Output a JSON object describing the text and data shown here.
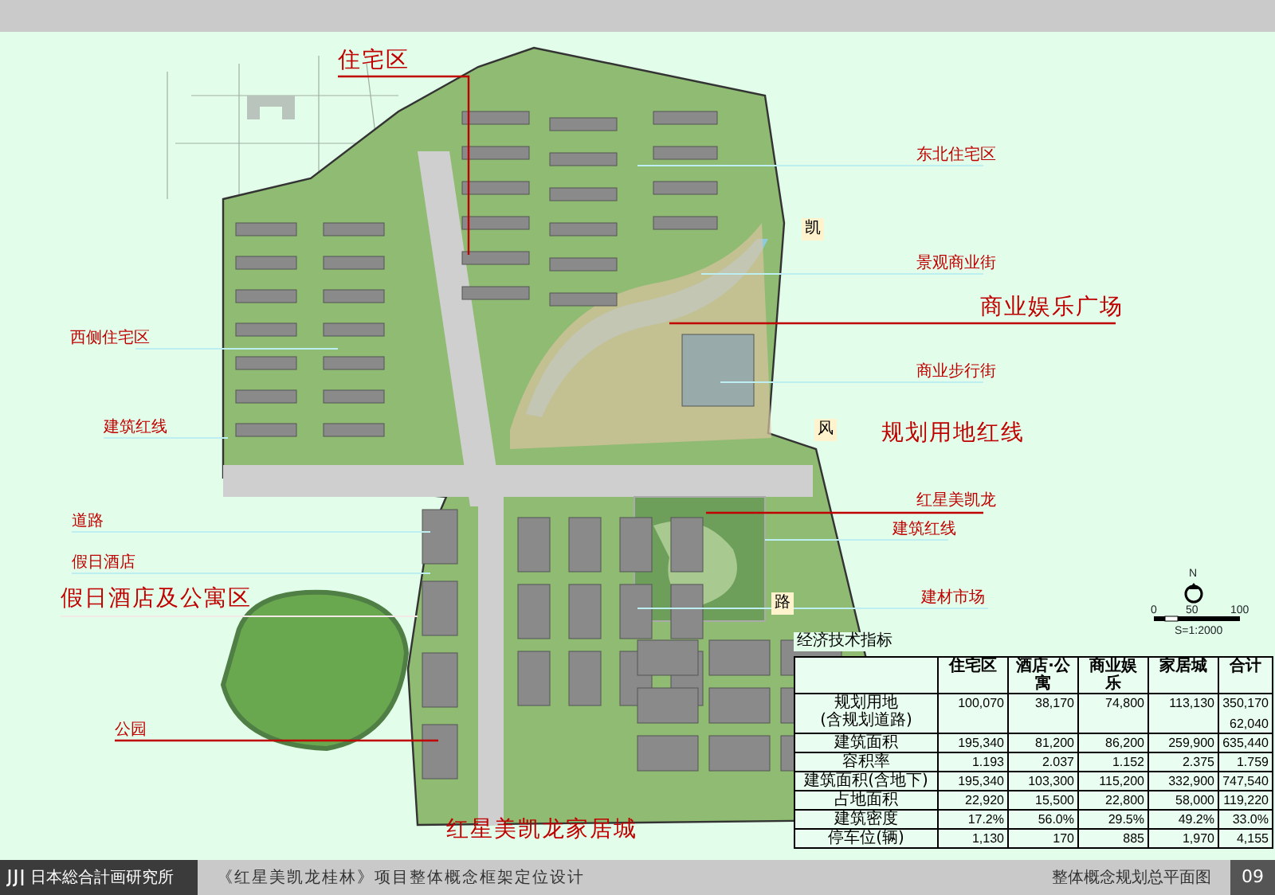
{
  "plan_labels": [
    {
      "kind": "zone",
      "text": "住宅区"
    },
    {
      "kind": "note",
      "text": "东北住宅区"
    },
    {
      "kind": "note",
      "text": "景观商业街"
    },
    {
      "kind": "zone",
      "text": "商业娱乐广场"
    },
    {
      "kind": "note",
      "text": "商业步行街"
    },
    {
      "kind": "zone",
      "text": "规划用地红线"
    },
    {
      "kind": "note",
      "text": "红星美凯龙"
    },
    {
      "kind": "note",
      "text": "建筑红线"
    },
    {
      "kind": "note",
      "text": "建材市场"
    },
    {
      "kind": "note",
      "text": "西侧住宅区"
    },
    {
      "kind": "note",
      "text": "建筑红线"
    },
    {
      "kind": "note",
      "text": "道路"
    },
    {
      "kind": "note",
      "text": "假日酒店"
    },
    {
      "kind": "zone",
      "text": "假日酒店及公寓区"
    },
    {
      "kind": "note",
      "text": "公园"
    },
    {
      "kind": "zone",
      "text": "红星美凯龙家居城"
    }
  ],
  "map_marks": [
    "凯",
    "风",
    "路"
  ],
  "compass": {
    "label": "N"
  },
  "scale_bar": {
    "ticks": [
      "0",
      "50",
      "100"
    ],
    "ratio": "S=1:2000"
  },
  "table": {
    "title": "经济技术指标",
    "columns": [
      "住宅区",
      "酒店·公寓",
      "商业娱乐",
      "家居城",
      "合计"
    ],
    "rows": [
      {
        "label": "规划用地",
        "note": "(含规划道路)",
        "cells": [
          "100,070",
          "38,170",
          "74,800",
          "113,130",
          "350,170"
        ],
        "total_note": "62,040"
      },
      {
        "label": "建筑面积",
        "cells": [
          "195,340",
          "81,200",
          "86,200",
          "259,900",
          "635,440"
        ]
      },
      {
        "label": "容积率",
        "cells": [
          "1.193",
          "2.037",
          "1.152",
          "2.375",
          "1.759"
        ]
      },
      {
        "label": "建筑面积(含地下)",
        "cells": [
          "195,340",
          "103,300",
          "115,200",
          "332,900",
          "747,540"
        ]
      },
      {
        "label": "占地面积",
        "cells": [
          "22,920",
          "15,500",
          "22,800",
          "58,000",
          "119,220"
        ]
      },
      {
        "label": "建筑密度",
        "cells": [
          "17.2%",
          "56.0%",
          "29.5%",
          "49.2%",
          "33.0%"
        ]
      },
      {
        "label": "停车位(辆)",
        "cells": [
          "1,130",
          "170",
          "885",
          "1,970",
          "4,155"
        ]
      }
    ]
  },
  "footer": {
    "logo": "日本総合計画研究所",
    "title": "《红星美凯龙桂林》项目整体概念框架定位设计",
    "subtitle": "整体概念规划总平面图",
    "page": "09"
  }
}
